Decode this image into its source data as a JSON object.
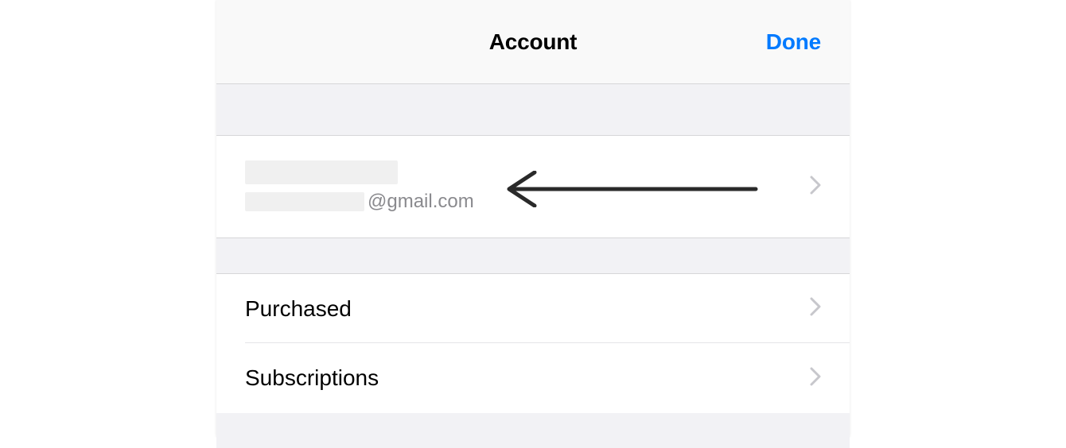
{
  "header": {
    "title": "Account",
    "done_label": "Done"
  },
  "account_row": {
    "email_suffix": "@gmail.com"
  },
  "menu": {
    "purchased_label": "Purchased",
    "subscriptions_label": "Subscriptions"
  },
  "colors": {
    "accent": "#007aff",
    "chevron": "#c7c7cc",
    "arrow": "#2a2a2a"
  }
}
